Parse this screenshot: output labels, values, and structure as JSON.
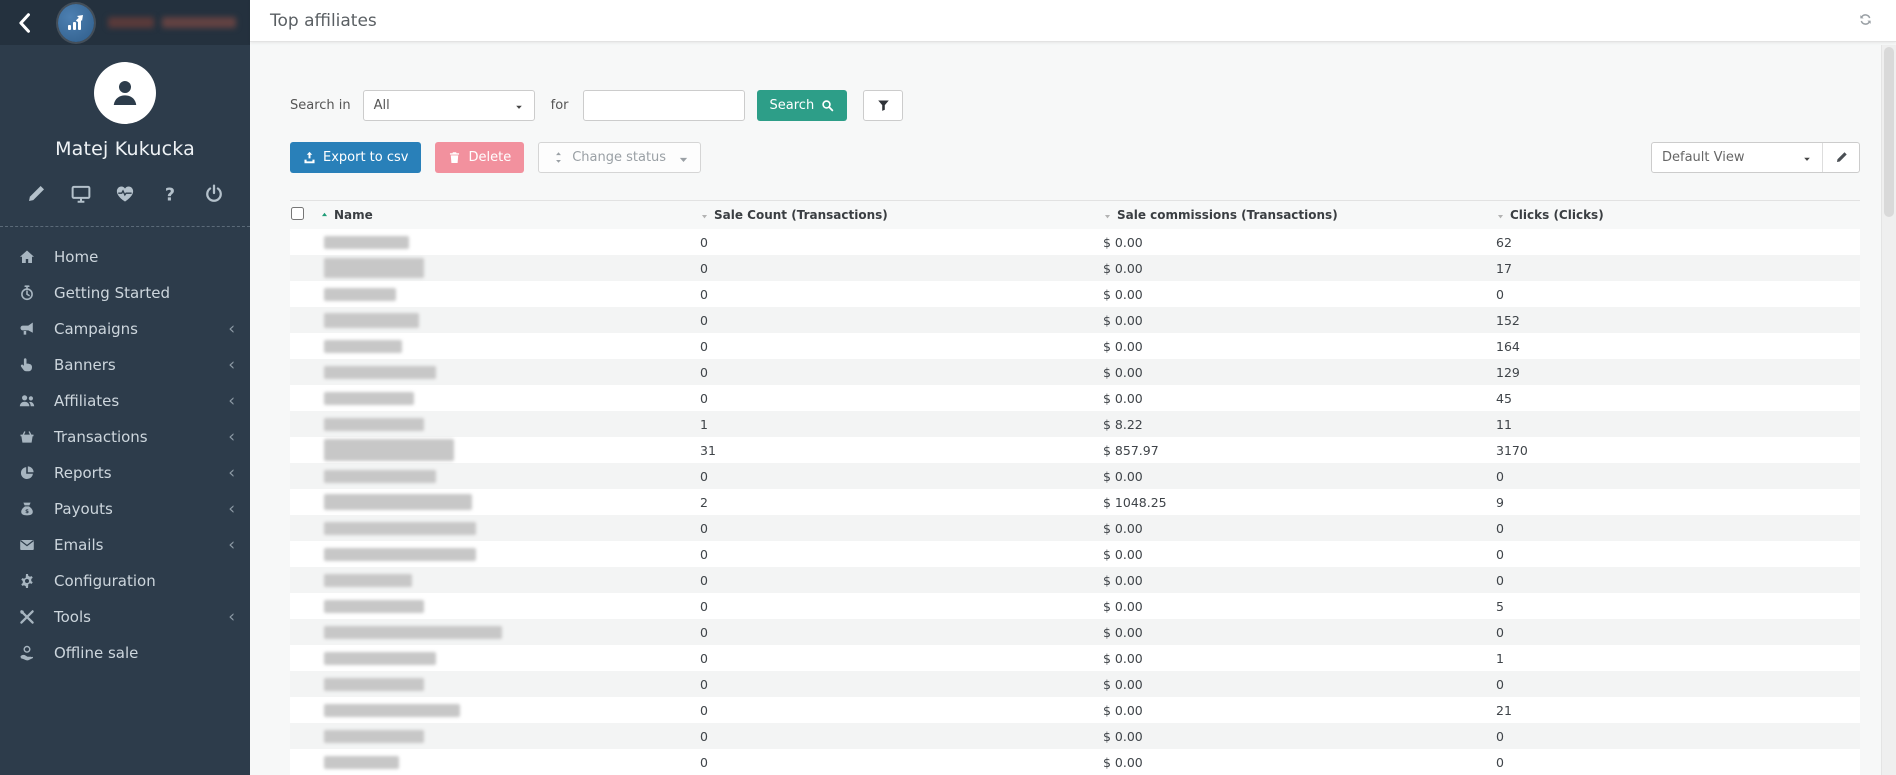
{
  "sidebar": {
    "user_name": "Matej Kukucka",
    "quick_icons": [
      "pencil",
      "monitor",
      "heartbeat",
      "question",
      "power"
    ],
    "nav": [
      {
        "label": "Home",
        "icon": "home",
        "chevron": false
      },
      {
        "label": "Getting Started",
        "icon": "stopwatch",
        "chevron": false
      },
      {
        "label": "Campaigns",
        "icon": "megaphone",
        "chevron": true
      },
      {
        "label": "Banners",
        "icon": "hand-pointer",
        "chevron": true
      },
      {
        "label": "Affiliates",
        "icon": "users",
        "chevron": true
      },
      {
        "label": "Transactions",
        "icon": "basket",
        "chevron": true
      },
      {
        "label": "Reports",
        "icon": "pie-chart",
        "chevron": true
      },
      {
        "label": "Payouts",
        "icon": "money-bag",
        "chevron": true
      },
      {
        "label": "Emails",
        "icon": "envelope",
        "chevron": true
      },
      {
        "label": "Configuration",
        "icon": "gear",
        "chevron": false
      },
      {
        "label": "Tools",
        "icon": "tools",
        "chevron": true
      },
      {
        "label": "Offline sale",
        "icon": "offline-sale",
        "chevron": false
      }
    ],
    "chevron_char": "‹"
  },
  "header": {
    "title": "Top affiliates"
  },
  "search": {
    "label_in": "Search in",
    "scope_value": "All",
    "label_for": "for",
    "input_value": "",
    "button_label": "Search"
  },
  "toolbar": {
    "export_label": "Export to csv",
    "delete_label": "Delete",
    "change_status_label": "Change status",
    "view_label": "Default View"
  },
  "table": {
    "columns": [
      "Name",
      "Sale Count (Transactions)",
      "Sale commissions (Transactions)",
      "Clicks (Clicks)"
    ],
    "sorted_column": "Name",
    "sort_direction": "asc",
    "rows": [
      {
        "name_redacted": true,
        "blob_w": 85,
        "blob_h": 13,
        "sale_count": "0",
        "commissions": "$ 0.00",
        "clicks": "62"
      },
      {
        "name_redacted": true,
        "blob_w": 100,
        "blob_h": 20,
        "sale_count": "0",
        "commissions": "$ 0.00",
        "clicks": "17"
      },
      {
        "name_redacted": true,
        "blob_w": 72,
        "blob_h": 13,
        "sale_count": "0",
        "commissions": "$ 0.00",
        "clicks": "0"
      },
      {
        "name_redacted": true,
        "blob_w": 95,
        "blob_h": 15,
        "sale_count": "0",
        "commissions": "$ 0.00",
        "clicks": "152"
      },
      {
        "name_redacted": true,
        "blob_w": 78,
        "blob_h": 13,
        "sale_count": "0",
        "commissions": "$ 0.00",
        "clicks": "164"
      },
      {
        "name_redacted": true,
        "blob_w": 112,
        "blob_h": 13,
        "sale_count": "0",
        "commissions": "$ 0.00",
        "clicks": "129"
      },
      {
        "name_redacted": true,
        "blob_w": 90,
        "blob_h": 13,
        "sale_count": "0",
        "commissions": "$ 0.00",
        "clicks": "45"
      },
      {
        "name_redacted": true,
        "blob_w": 100,
        "blob_h": 13,
        "sale_count": "1",
        "commissions": "$ 8.22",
        "clicks": "11"
      },
      {
        "name_redacted": true,
        "blob_w": 130,
        "blob_h": 22,
        "sale_count": "31",
        "commissions": "$ 857.97",
        "clicks": "3170"
      },
      {
        "name_redacted": true,
        "blob_w": 112,
        "blob_h": 13,
        "sale_count": "0",
        "commissions": "$ 0.00",
        "clicks": "0"
      },
      {
        "name_redacted": true,
        "blob_w": 148,
        "blob_h": 16,
        "sale_count": "2",
        "commissions": "$ 1048.25",
        "clicks": "9"
      },
      {
        "name_redacted": true,
        "blob_w": 152,
        "blob_h": 13,
        "sale_count": "0",
        "commissions": "$ 0.00",
        "clicks": "0"
      },
      {
        "name_redacted": true,
        "blob_w": 152,
        "blob_h": 13,
        "sale_count": "0",
        "commissions": "$ 0.00",
        "clicks": "0"
      },
      {
        "name_redacted": true,
        "blob_w": 88,
        "blob_h": 13,
        "sale_count": "0",
        "commissions": "$ 0.00",
        "clicks": "0"
      },
      {
        "name_redacted": true,
        "blob_w": 100,
        "blob_h": 13,
        "sale_count": "0",
        "commissions": "$ 0.00",
        "clicks": "5"
      },
      {
        "name_redacted": true,
        "blob_w": 178,
        "blob_h": 13,
        "sale_count": "0",
        "commissions": "$ 0.00",
        "clicks": "0"
      },
      {
        "name_redacted": true,
        "blob_w": 112,
        "blob_h": 13,
        "sale_count": "0",
        "commissions": "$ 0.00",
        "clicks": "1"
      },
      {
        "name_redacted": true,
        "blob_w": 100,
        "blob_h": 13,
        "sale_count": "0",
        "commissions": "$ 0.00",
        "clicks": "0"
      },
      {
        "name_redacted": true,
        "blob_w": 136,
        "blob_h": 13,
        "sale_count": "0",
        "commissions": "$ 0.00",
        "clicks": "21"
      },
      {
        "name_redacted": true,
        "blob_w": 100,
        "blob_h": 13,
        "sale_count": "0",
        "commissions": "$ 0.00",
        "clicks": "0"
      },
      {
        "name_redacted": true,
        "blob_w": 75,
        "blob_h": 13,
        "sale_count": "0",
        "commissions": "$ 0.00",
        "clicks": "0"
      }
    ]
  },
  "colors": {
    "sidebar_bg": "#2d3c4b",
    "sidebar_top_bg": "#24313e",
    "accent_teal": "#2d9e88",
    "export_blue": "#2980b9",
    "delete_pink": "#f2919e",
    "sort_active": "#1f9d77",
    "page_bg": "#f7f8f8"
  }
}
